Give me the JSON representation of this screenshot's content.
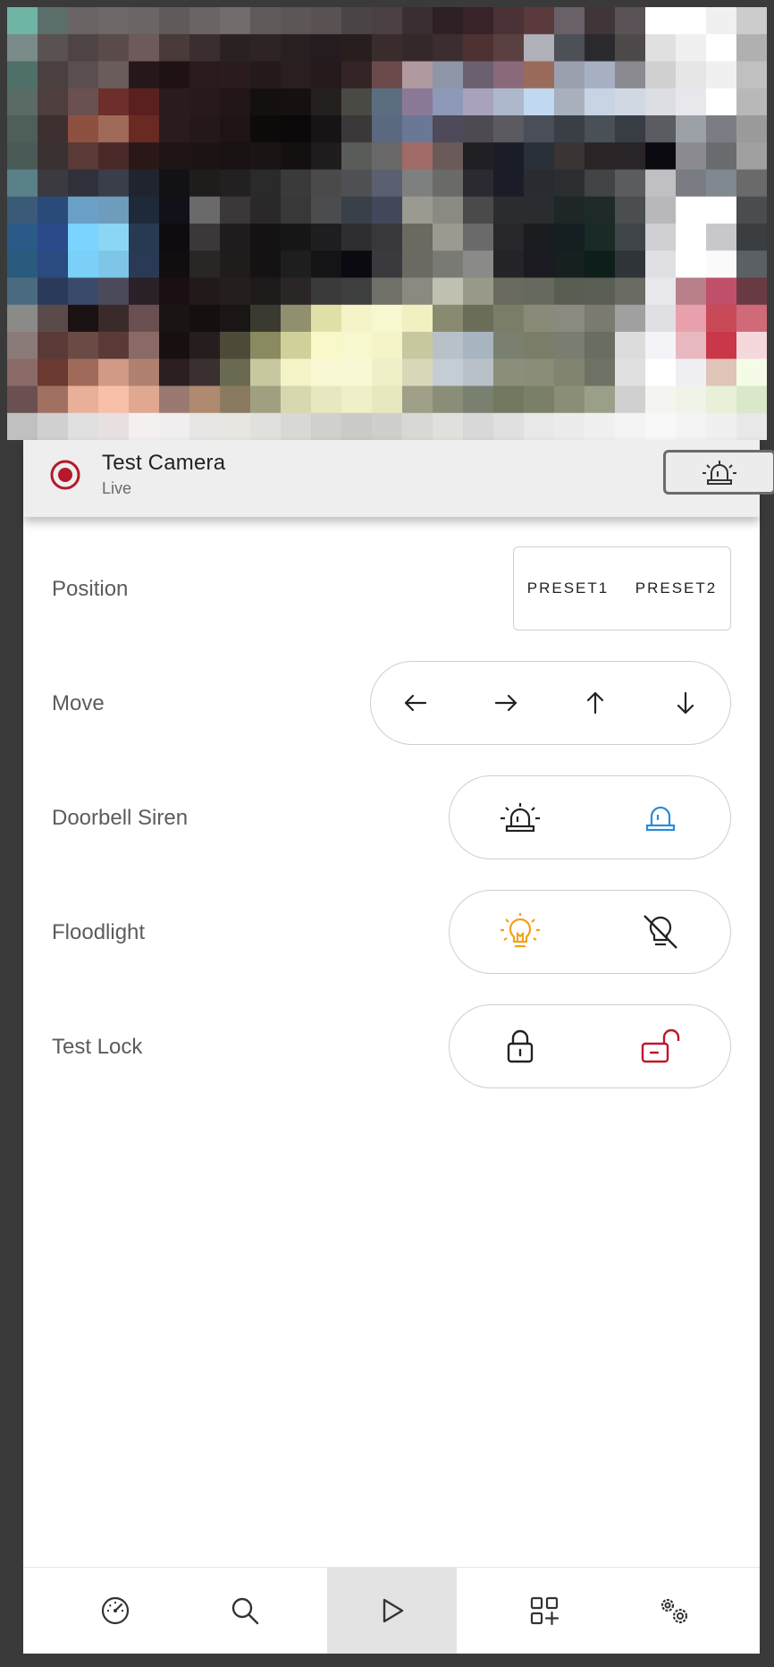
{
  "camera": {
    "title": "Test Camera",
    "status": "Live",
    "header_action_icon": "siren-icon",
    "record_color": "#b5192b"
  },
  "controls": {
    "position": {
      "label": "Position",
      "presets": [
        "PRESET1",
        "PRESET2"
      ]
    },
    "move": {
      "label": "Move",
      "icons": [
        "arrow-left-icon",
        "arrow-right-icon",
        "arrow-up-icon",
        "arrow-down-icon"
      ]
    },
    "doorbell_siren": {
      "label": "Doorbell Siren",
      "icons": [
        "siren-on-icon",
        "siren-off-icon"
      ],
      "active_color": "#2a8bd8"
    },
    "floodlight": {
      "label": "Floodlight",
      "icons": [
        "lightbulb-on-icon",
        "lightbulb-off-icon"
      ],
      "on_color": "#f5a017"
    },
    "lock": {
      "label": "Test Lock",
      "icons": [
        "lock-closed-icon",
        "lock-open-icon"
      ],
      "unlocked_color": "#c0152a"
    }
  },
  "nav": {
    "items": [
      "dashboard-icon",
      "search-icon",
      "play-icon",
      "add-widget-icon",
      "settings-icon"
    ],
    "active_index": 2
  }
}
